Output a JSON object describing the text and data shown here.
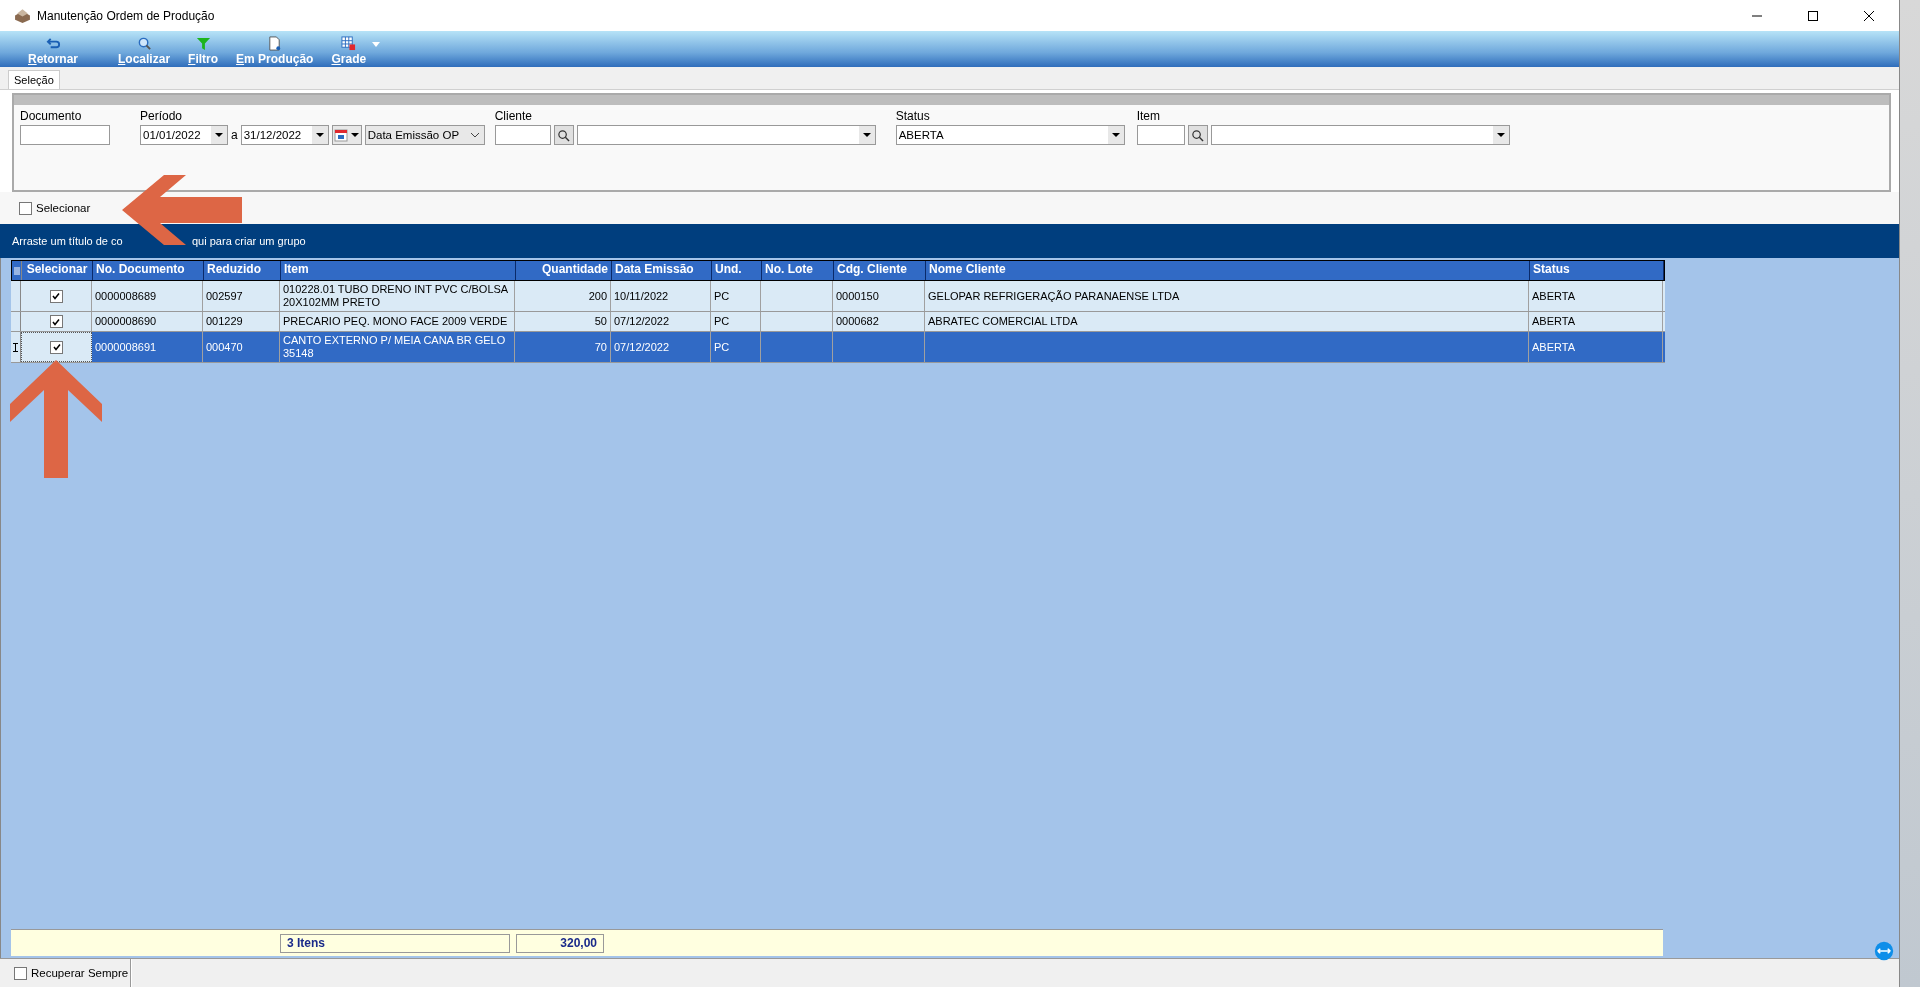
{
  "window": {
    "title": "Manutenção Ordem de Produção"
  },
  "toolbar": [
    {
      "kind": "back",
      "label": "Retornar"
    },
    {
      "kind": "find",
      "label": "Localizar"
    },
    {
      "kind": "filter",
      "label": "Filtro"
    },
    {
      "kind": "doc",
      "label": "Em Produção"
    },
    {
      "kind": "grid",
      "label": "Grade"
    }
  ],
  "tabs": [
    {
      "label": "Seleção",
      "selected": true
    }
  ],
  "filters": {
    "documento": {
      "label": "Documento"
    },
    "periodo": {
      "label": "Período",
      "from": "01/01/2022",
      "separator": "a",
      "to": "31/12/2022",
      "date_field": "Data Emissão OP"
    },
    "cliente": {
      "label": "Cliente"
    },
    "status": {
      "label": "Status",
      "value": "ABERTA"
    },
    "item": {
      "label": "Item"
    }
  },
  "select_all": {
    "label": "Selecionar",
    "checked": false
  },
  "group_panel": {
    "text_before": "Arraste um título de co",
    "text_after": "qui para criar um grupo"
  },
  "table": {
    "columns": [
      {
        "label": "Selecionar"
      },
      {
        "label": "No. Documento"
      },
      {
        "label": "Reduzido"
      },
      {
        "label": "Item"
      },
      {
        "label": "Quantidade"
      },
      {
        "label": "Data Emissão"
      },
      {
        "label": "Und."
      },
      {
        "label": "No. Lote"
      },
      {
        "label": "Cdg. Cliente"
      },
      {
        "label": "Nome Cliente"
      },
      {
        "label": "Status"
      }
    ],
    "rows": [
      {
        "checked": true,
        "selected": false,
        "cells": [
          "",
          "0000008689",
          "002597",
          " 010228.01 TUBO DRENO INT PVC C/BOLSA 20X102MM PRETO",
          "200",
          "10/11/2022",
          "PC",
          "",
          "0000150",
          "GELOPAR REFRIGERAÇÃO PARANAENSE LTDA",
          "ABERTA"
        ]
      },
      {
        "checked": true,
        "selected": false,
        "cells": [
          "",
          "0000008690",
          "001229",
          "PRECARIO PEQ. MONO FACE 2009 VERDE",
          "50",
          "07/12/2022",
          "PC",
          "",
          "0000682",
          "ABRATEC COMERCIAL LTDA",
          "ABERTA"
        ]
      },
      {
        "checked": true,
        "selected": true,
        "cells": [
          "",
          "0000008691",
          "000470",
          "CANTO EXTERNO P/ MEIA CANA BR GELO 35148",
          "70",
          "07/12/2022",
          "PC",
          "",
          "",
          "",
          "ABERTA"
        ]
      }
    ],
    "footer": {
      "count": "3 Itens",
      "total": "320,00"
    }
  },
  "status_bar": {
    "label": "Recuperar Sempre",
    "checked": false
  }
}
